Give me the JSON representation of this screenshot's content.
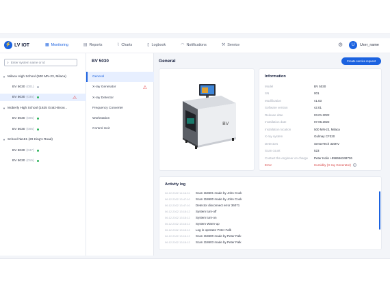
{
  "app": {
    "logo_text": "LV IOT",
    "logo_glyph": "⚡"
  },
  "nav": [
    {
      "label": "Monitoring",
      "icon": "grid-icon",
      "glyph": "▦",
      "active": true
    },
    {
      "label": "Reports",
      "icon": "report-icon",
      "glyph": "▤",
      "active": false
    },
    {
      "label": "Charts",
      "icon": "chart-icon",
      "glyph": "⌇",
      "active": false
    },
    {
      "label": "Logbook",
      "icon": "logbook-icon",
      "glyph": "▯",
      "active": false
    },
    {
      "label": "Notifications",
      "icon": "bell-icon",
      "glyph": "◠",
      "active": false
    },
    {
      "label": "Service",
      "icon": "wrench-icon",
      "glyph": "⚒",
      "active": false
    }
  ],
  "user": {
    "avatar_initial": "U",
    "name": "User_name"
  },
  "search": {
    "placeholder": "Enter system name or id"
  },
  "tree": {
    "groups": [
      {
        "label": "Milaca High School (500 MN-23, Milaca)"
      },
      {
        "label": "Moberly High School (1625 Gratz-Brow..."
      },
      {
        "label": "School №181 (29 King's Road)"
      }
    ],
    "devices": [
      {
        "name": "BV 5030",
        "serial": "(001)",
        "status": "gray"
      },
      {
        "name": "BV 5030",
        "serial": "(035)",
        "status": "green",
        "warning": true
      },
      {
        "name": "BV 5030",
        "serial": "(005)",
        "status": "green"
      },
      {
        "name": "BV 5030",
        "serial": "(005)",
        "status": "green"
      },
      {
        "name": "BV 5030",
        "serial": "(047)",
        "status": "green"
      },
      {
        "name": "BV 5030",
        "serial": "(015)",
        "status": "green"
      }
    ]
  },
  "menu": {
    "title": "BV 5030",
    "items": [
      {
        "label": "General",
        "active": true
      },
      {
        "label": "X-ray Generator",
        "warning": true
      },
      {
        "label": "X-ray Detector"
      },
      {
        "label": "Frequency Converter"
      },
      {
        "label": "Workstation"
      },
      {
        "label": "Control Unit"
      }
    ]
  },
  "content": {
    "title": "General",
    "service_button": "Create service request",
    "image_label": "BV"
  },
  "info": {
    "title": "Information",
    "rows": [
      {
        "label": "Model",
        "value": "BV 5030"
      },
      {
        "label": "SN",
        "value": "001"
      },
      {
        "label": "Modification",
        "value": "v1.03"
      },
      {
        "label": "Software version",
        "value": "v2.01"
      },
      {
        "label": "Release date",
        "value": "03.01.2022"
      },
      {
        "label": "Installation date",
        "value": "07.06.2022"
      },
      {
        "label": "Installation location",
        "value": "500 MN-23, Milaca"
      },
      {
        "label": "X-ray system",
        "value": "Gulmay CF320"
      },
      {
        "label": "Detectors",
        "value": "SenseTech 320KV"
      },
      {
        "label": "Scan count",
        "value": "523"
      },
      {
        "label": "Contact the engineer on charge",
        "value": "Peter Kolin  +896556348726"
      },
      {
        "label": "Error",
        "value": "Humidity (X-ray Generator)",
        "error": true
      }
    ]
  },
  "activity": {
    "title": "Activity log",
    "rows": [
      {
        "time": "06.12.2022 14:16:01",
        "message": "Scan 118601 made by John Cook"
      },
      {
        "time": "06.12.2022 13:47:10",
        "message": "Scan 118600 made by John Cook"
      },
      {
        "time": "06.12.2022 13:47:10",
        "message": "Detector disconnect error 36071"
      },
      {
        "time": "06.12.2022 13:15:12",
        "message": "System turn-off"
      },
      {
        "time": "06.12.2022 13:15:12",
        "message": "System turn-on"
      },
      {
        "time": "06.12.2022 13:15:12",
        "message": "System Warm-up"
      },
      {
        "time": "06.12.2022 13:15:12",
        "message": "Log in operator Peter Falk"
      },
      {
        "time": "06.12.2022 13:15:12",
        "message": "Scan 118600 made by Peter Falk"
      },
      {
        "time": "06.12.2022 13:15:12",
        "message": "Scan 118603 made by Peter Falk"
      }
    ]
  },
  "colors": {
    "accent": "#1b62e0",
    "ok": "#2eb35c",
    "error": "#e5484d"
  }
}
